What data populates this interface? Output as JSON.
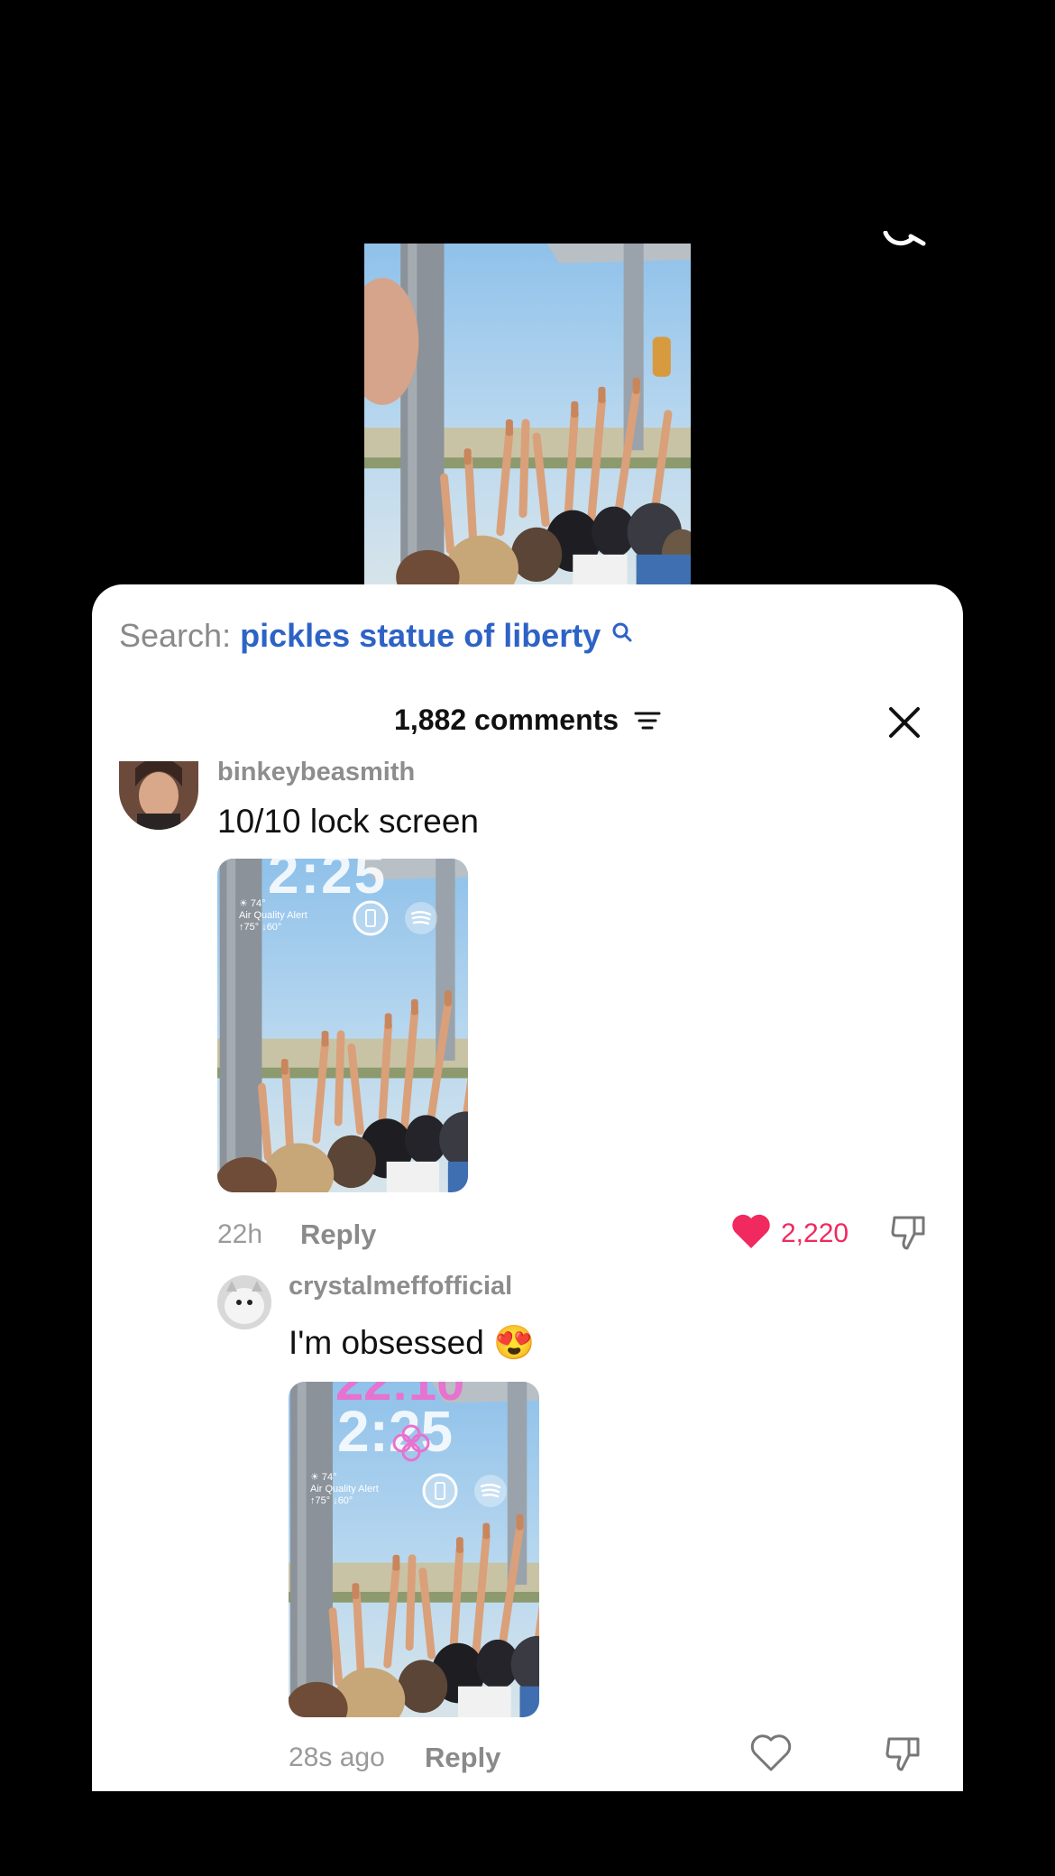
{
  "search": {
    "prefix": "Search:",
    "query": "pickles statue of liberty"
  },
  "header": {
    "count_label": "1,882 comments"
  },
  "comments": [
    {
      "username": "binkeybeasmith",
      "text": "10/10 lock screen",
      "image": {
        "clock": "2:25",
        "weather": "☀ 74°",
        "weather_line2": "Air Quality Alert",
        "weather_line3": "↑75° ↓60°"
      },
      "time": "22h",
      "reply_label": "Reply",
      "likes": "2,220",
      "liked": true
    },
    {
      "username": "crystalmeffofficial",
      "text": "I'm obsessed 😍",
      "image": {
        "clock_top": "22:10",
        "clock": "2:25",
        "weather": "☀ 74°",
        "weather_line2": "Air Quality Alert",
        "weather_line3": "↑75° ↓60°"
      },
      "time": "28s ago",
      "reply_label": "Reply",
      "liked": false
    }
  ],
  "colors": {
    "accent_like": "#f0295e",
    "search_query": "#2e63c6"
  }
}
